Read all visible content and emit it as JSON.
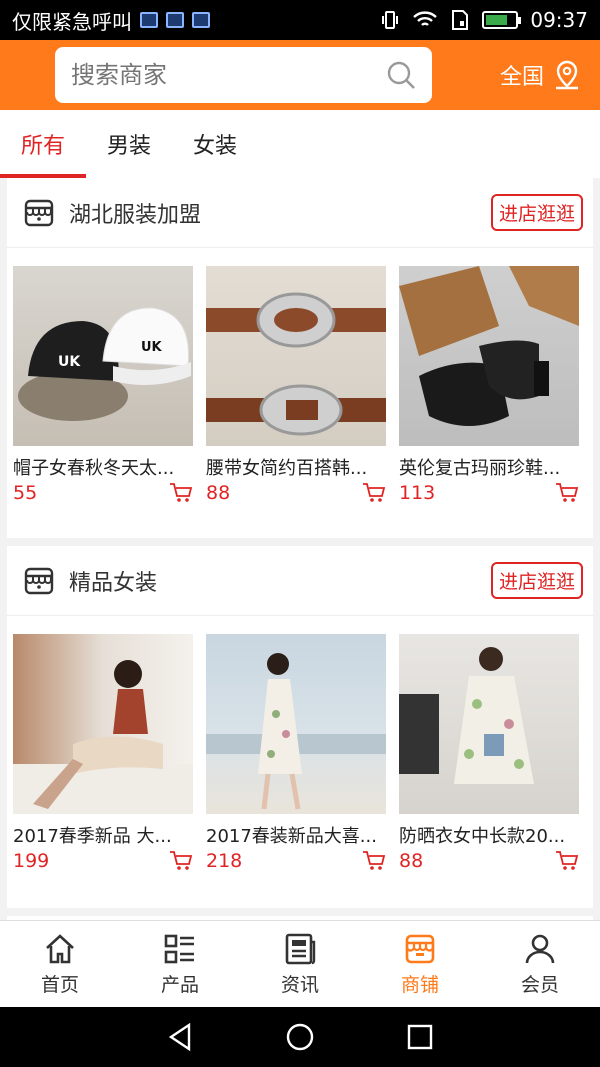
{
  "status_bar": {
    "carrier": "仅限紧急呼叫",
    "time": "09:37",
    "battery_level": 0.75
  },
  "header": {
    "search_placeholder": "搜索商家",
    "region_label": "全国"
  },
  "tabs": [
    {
      "label": "所有",
      "active": true
    },
    {
      "label": "男装",
      "active": false
    },
    {
      "label": "女装",
      "active": false
    }
  ],
  "shops": [
    {
      "name": "湖北服装加盟",
      "enter_label": "进店逛逛",
      "products": [
        {
          "name": "帽子女春秋冬天太...",
          "price": "55"
        },
        {
          "name": "腰带女简约百搭韩...",
          "price": "88"
        },
        {
          "name": "英伦复古玛丽珍鞋...",
          "price": "113"
        }
      ]
    },
    {
      "name": "精品女装",
      "enter_label": "进店逛逛",
      "products": [
        {
          "name": "2017春季新品 大...",
          "price": "199"
        },
        {
          "name": "2017春装新品大喜...",
          "price": "218"
        },
        {
          "name": "防晒衣女中长款20...",
          "price": "88"
        }
      ]
    }
  ],
  "bottom_nav": [
    {
      "label": "首页",
      "icon": "home-icon",
      "active": false
    },
    {
      "label": "产品",
      "icon": "list-icon",
      "active": false
    },
    {
      "label": "资讯",
      "icon": "news-icon",
      "active": false
    },
    {
      "label": "商铺",
      "icon": "shop-icon",
      "active": true
    },
    {
      "label": "会员",
      "icon": "user-icon",
      "active": false
    }
  ],
  "colors": {
    "brand": "#ff7a1a",
    "accent_red": "#e02424"
  }
}
